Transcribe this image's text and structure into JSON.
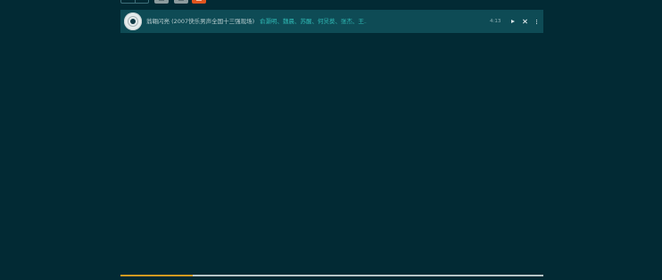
{
  "toolbar": {
    "orange_accent": "#e0551f"
  },
  "track": {
    "title": "翁翱闪亮 (2007快乐男声全国十三强现场)",
    "artists": "俞灏明、魏晨、苏醒、何炅葵、张杰、王...",
    "duration": "4:13"
  },
  "playback": {
    "progress_fraction": 0.17
  },
  "colors": {
    "background": "#022a34",
    "row": "#0e4b55",
    "artist_link": "#2fb8b4",
    "progress_fill": "#d29a21",
    "progress_track": "#b7c4c6"
  },
  "icons": {
    "disc": "disc-icon",
    "play": "play-icon",
    "close": "close-icon",
    "more": "more-vertical-icon"
  }
}
